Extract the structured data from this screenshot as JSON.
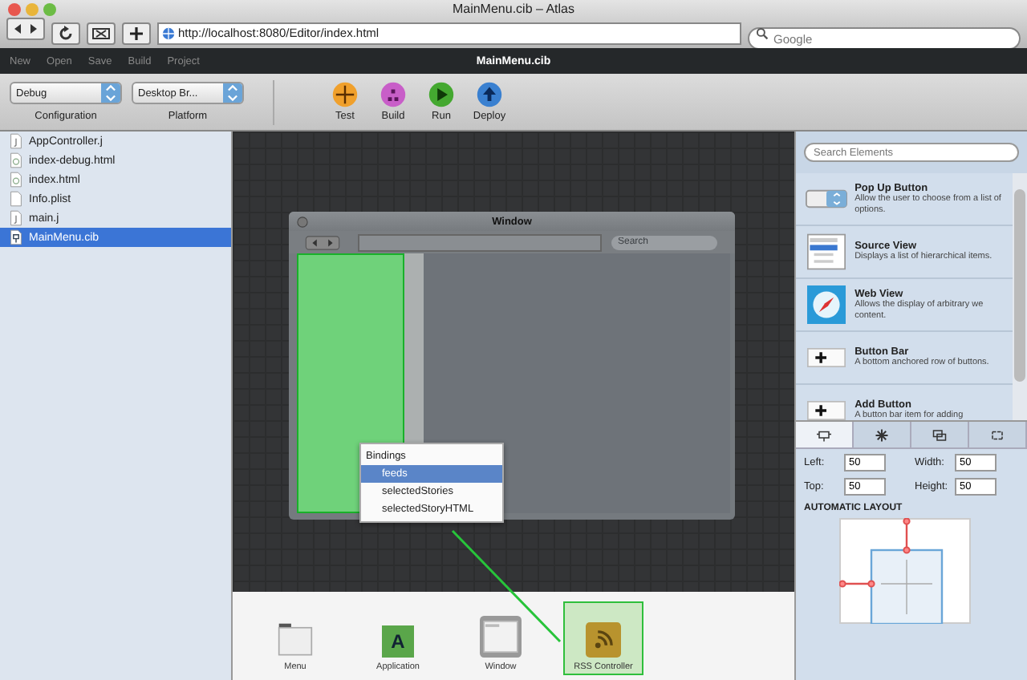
{
  "window": {
    "title": "MainMenu.cib – Atlas"
  },
  "browser": {
    "url": "http://localhost:8080/Editor/index.html",
    "search_placeholder": "Google"
  },
  "menu": [
    "New",
    "Open",
    "Save",
    "Build",
    "Project"
  ],
  "document_title": "MainMenu.cib",
  "toolbar": {
    "selects": [
      {
        "value": "Debug",
        "label": "Configuration"
      },
      {
        "value": "Desktop Br...",
        "label": "Platform"
      }
    ],
    "actions": [
      {
        "label": "Test",
        "kind": "test",
        "color": "#f0a02c"
      },
      {
        "label": "Build",
        "kind": "build",
        "color": "#c85ec8"
      },
      {
        "label": "Run",
        "kind": "run",
        "color": "#44a830"
      },
      {
        "label": "Deploy",
        "kind": "deploy",
        "color": "#3a80d0"
      }
    ]
  },
  "files": [
    {
      "name": "AppController.j",
      "kind": "code",
      "selected": false
    },
    {
      "name": "index-debug.html",
      "kind": "web",
      "selected": false
    },
    {
      "name": "index.html",
      "kind": "web",
      "selected": false
    },
    {
      "name": "Info.plist",
      "kind": "plain",
      "selected": false
    },
    {
      "name": "main.j",
      "kind": "code",
      "selected": false
    },
    {
      "name": "MainMenu.cib",
      "kind": "cib",
      "selected": true
    }
  ],
  "canvas": {
    "window": {
      "title": "Window",
      "search_placeholder": "Search"
    },
    "bindings": {
      "title": "Bindings",
      "items": [
        {
          "label": "feeds",
          "selected": true
        },
        {
          "label": "selectedStories",
          "selected": false
        },
        {
          "label": "selectedStoryHTML",
          "selected": false
        }
      ]
    }
  },
  "tray": [
    {
      "label": "Menu",
      "kind": "menu",
      "selected": false
    },
    {
      "label": "Application",
      "kind": "application",
      "letter": "A",
      "selected": false
    },
    {
      "label": "Window",
      "kind": "window",
      "selected": false
    },
    {
      "label": "RSS Controller",
      "kind": "rss",
      "selected": true
    }
  ],
  "library": {
    "search_placeholder": "Search Elements",
    "items": [
      {
        "title": "Pop Up Button",
        "description": "Allow the user to choose from a list of options.",
        "kind": "popup"
      },
      {
        "title": "Source View",
        "description": "Displays a list of hierarchical items.",
        "kind": "source"
      },
      {
        "title": "Web View",
        "description": "Allows the display of arbitrary we content.",
        "kind": "web"
      },
      {
        "title": "Button Bar",
        "description": "A bottom anchored row of buttons.",
        "kind": "buttonbar"
      },
      {
        "title": "Add Button",
        "description": "A button bar item for adding",
        "kind": "addbutton"
      }
    ]
  },
  "inspector": {
    "tabs": [
      {
        "kind": "size",
        "selected": true
      },
      {
        "kind": "settings",
        "selected": false
      },
      {
        "kind": "windows",
        "selected": false
      },
      {
        "kind": "bindings",
        "selected": false
      }
    ],
    "fields": [
      {
        "label": "Left:",
        "value": "50"
      },
      {
        "label": "Width:",
        "value": "50"
      },
      {
        "label": "Top:",
        "value": "50"
      },
      {
        "label": "Height:",
        "value": "50"
      }
    ],
    "section": "AUTOMATIC LAYOUT"
  }
}
